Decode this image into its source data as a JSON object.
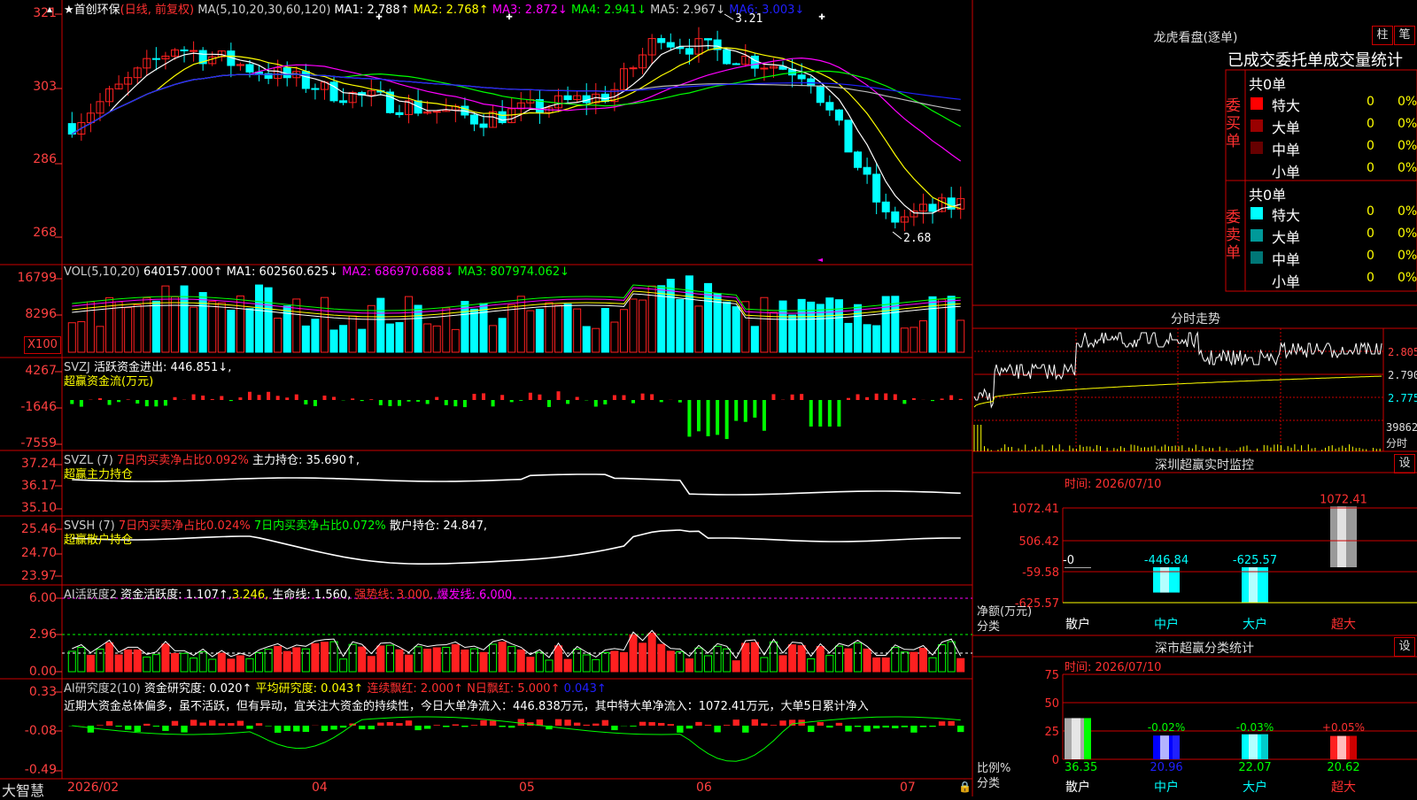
{
  "kline": {
    "title": "首创环保",
    "period": "(日线, 前复权)",
    "ma_header": "MA(5,10,20,30,60,120)",
    "ma_values": [
      {
        "label": "MA1: 2.788↑",
        "color": "#ffffff"
      },
      {
        "label": "MA2: 2.768↑",
        "color": "#ffff00"
      },
      {
        "label": "MA3: 2.872↓",
        "color": "#ff00ff"
      },
      {
        "label": "MA4: 2.941↓",
        "color": "#00ff00"
      },
      {
        "label": "MA5: 2.967↓",
        "color": "#cccccc"
      },
      {
        "label": "MA6: 3.003↓",
        "color": "#2020ff"
      }
    ],
    "y_ticks": [
      "321",
      "303",
      "286",
      "268"
    ],
    "high_mark": "3.21",
    "low_mark": "2.68"
  },
  "vol": {
    "header": "VOL(5,10,20)",
    "value": "640157.000↑",
    "mas": [
      {
        "label": "MA1: 602560.625↓",
        "color": "#ffffff"
      },
      {
        "label": "MA2: 686970.688↓",
        "color": "#ff00ff"
      },
      {
        "label": "MA3: 807974.062↓",
        "color": "#00ff00"
      }
    ],
    "y_ticks": [
      "16799",
      "8296"
    ],
    "unit": "X100"
  },
  "svzj": {
    "header": "SVZJ",
    "text": "活跃资金进出: 446.851↓,",
    "sub": "超赢资金流(万元)",
    "y_ticks": [
      "4267",
      "-1646",
      "-7559"
    ]
  },
  "svzl": {
    "header": "SVZL (7)",
    "pct": "7日内买卖净占比0.092%",
    "hold": "主力持仓: 35.690↑,",
    "sub": "超赢主力持仓",
    "y_ticks": [
      "37.24",
      "36.17",
      "35.10"
    ]
  },
  "svsh": {
    "header": "SVSH (7)",
    "pct1": "7日内买卖净占比0.024%",
    "pct2": "7日内买卖净占比0.072%",
    "hold": "散户持仓: 24.847,",
    "sub": "超赢散户持仓",
    "y_ticks": [
      "25.46",
      "24.70",
      "23.97"
    ]
  },
  "ai_active": {
    "header": "AI活跃度2",
    "l1": "资金活跃度: 1.107↑,",
    "l2": "3.246,",
    "l3": "生命线: 1.560,",
    "l4": "强势线: 3.000,",
    "l5": "爆发线: 6.000,",
    "y_ticks": [
      "6.00",
      "2.96",
      "0.00"
    ]
  },
  "ai_research": {
    "header": "AI研究度2(10)",
    "l1": "资金研究度: 0.020↑",
    "l2": "平均研究度: 0.043↑",
    "l3": "连续飘红: 2.000↑",
    "l4": "N日飘红: 5.000↑",
    "l5": "0.043↑",
    "note": "近期大资金总体偏多，虽不活跃，但有异动，宜关注大资金的持续性，今日大单净流入：446.838万元，其中特大单净流入：1072.41万元，大单5日累计净入",
    "y_ticks": [
      "0.33",
      "-0.08",
      "-0.49"
    ]
  },
  "xaxis": {
    "brand": "大智慧",
    "labels": [
      "2026/02",
      "04",
      "05",
      "06",
      "07"
    ]
  },
  "dragon": {
    "title": "龙虎看盘(逐单)",
    "btn_bar": "柱",
    "btn_tick": "笔",
    "subtitle": "已成交委托单成交量统计",
    "buy_label": "委买单",
    "sell_label": "委卖单",
    "buy_total": "共0单",
    "sell_total": "共0单",
    "buy_rows": [
      {
        "name": "特大",
        "count": "0",
        "pct": "0%",
        "color": "#ff0000"
      },
      {
        "name": "大单",
        "count": "0",
        "pct": "0%",
        "color": "#990000"
      },
      {
        "name": "中单",
        "count": "0",
        "pct": "0%",
        "color": "#660000"
      },
      {
        "name": "小单",
        "count": "0",
        "pct": "0%",
        "color": ""
      }
    ],
    "sell_rows": [
      {
        "name": "特大",
        "count": "0",
        "pct": "0%",
        "color": "#00ffff"
      },
      {
        "name": "大单",
        "count": "0",
        "pct": "0%",
        "color": "#009999"
      },
      {
        "name": "中单",
        "count": "0",
        "pct": "0%",
        "color": "#007777"
      },
      {
        "name": "小单",
        "count": "0",
        "pct": "0%",
        "color": ""
      }
    ]
  },
  "intraday": {
    "title": "分时走势",
    "prices": [
      "2.805",
      "2.790",
      "2.775"
    ],
    "vol": "39862",
    "vol_unit": "分时"
  },
  "monitor": {
    "title": "深圳超赢实时监控",
    "btn": "设",
    "time": "时间: 2026/07/10",
    "y_ticks": [
      "1072.41",
      "506.42",
      "-59.58",
      "-625.57"
    ],
    "ylabel": "净额(万元)",
    "xlabel": "分类",
    "categories": [
      "散户",
      "中户",
      "大户",
      "超大"
    ],
    "values": [
      0,
      -446.84,
      -625.57,
      1072.41
    ],
    "value_labels": [
      "-0",
      "-446.84",
      "-625.57",
      "1072.41"
    ]
  },
  "stats": {
    "title": "深市超赢分类统计",
    "btn": "设",
    "time": "时间: 2026/07/10",
    "y_ticks": [
      "75",
      "50",
      "25",
      "0"
    ],
    "ylabel": "比例%",
    "xlabel": "分类",
    "categories": [
      "散户",
      "中户",
      "大户",
      "超大"
    ],
    "values": [
      36.35,
      20.96,
      22.07,
      20.62
    ],
    "changes": [
      "",
      "-0.02%",
      "-0.03%",
      "+0.05%"
    ]
  },
  "chart_data": [
    {
      "type": "bar",
      "title": "深圳超赢实时监控",
      "categories": [
        "散户",
        "中户",
        "大户",
        "超大"
      ],
      "values": [
        0,
        -446.84,
        -625.57,
        1072.41
      ],
      "ylabel": "净额(万元)",
      "xlabel": "分类",
      "ylim": [
        -625.57,
        1072.41
      ]
    },
    {
      "type": "bar",
      "title": "深市超赢分类统计",
      "categories": [
        "散户",
        "中户",
        "大户",
        "超大"
      ],
      "values": [
        36.35,
        20.96,
        22.07,
        20.62
      ],
      "ylabel": "比例%",
      "xlabel": "分类",
      "ylim": [
        0,
        75
      ]
    }
  ]
}
